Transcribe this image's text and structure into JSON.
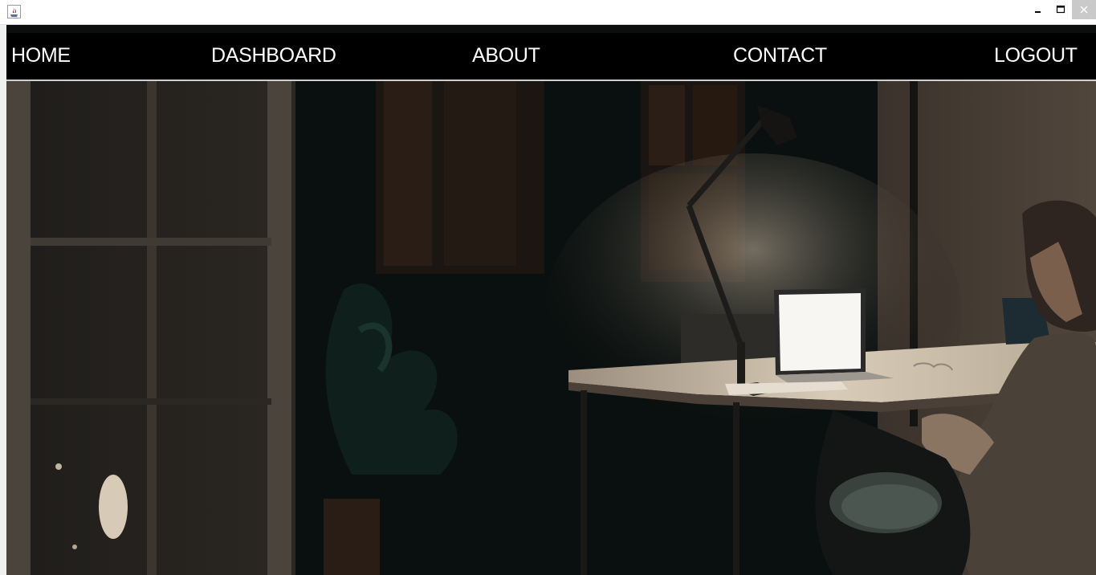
{
  "window": {
    "app_icon": "java-coffee-icon",
    "controls": {
      "minimize": "minimize-icon",
      "maximize": "maximize-icon",
      "close": "close-icon"
    }
  },
  "navbar": {
    "items": [
      {
        "label": "HOME"
      },
      {
        "label": "DASHBOARD"
      },
      {
        "label": "ABOUT"
      },
      {
        "label": "CONTACT"
      },
      {
        "label": "LOGOUT"
      }
    ]
  },
  "colors": {
    "navbar_bg": "#000000",
    "nav_text": "#ffffff",
    "titlebar_bg": "#ffffff"
  }
}
